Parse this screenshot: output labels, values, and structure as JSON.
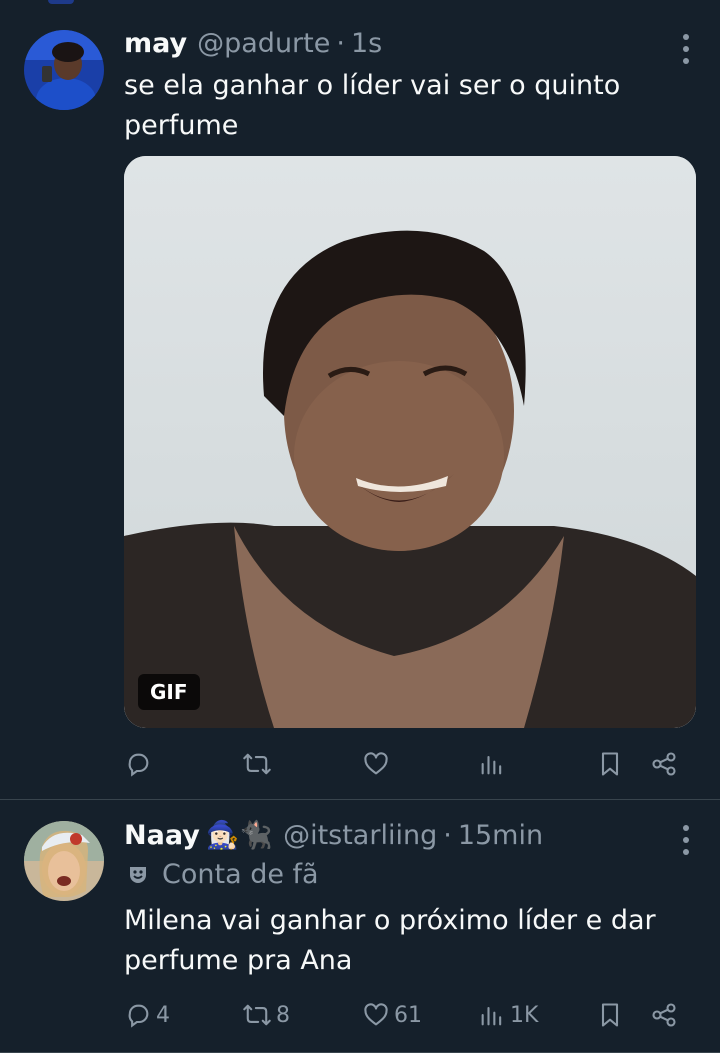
{
  "colors": {
    "background": "#15202b",
    "text": "#f7f9f9",
    "secondary": "#8b98a5",
    "divider": "#38444d"
  },
  "tweets": [
    {
      "name": "may",
      "handle": "@padurte",
      "separator": "·",
      "time": "1s",
      "text": "se ela ganhar o líder vai ser o quinto perfume",
      "media": {
        "type": "gif",
        "badge": "GIF"
      },
      "actions": {
        "reply": {
          "icon": "reply-icon",
          "count": ""
        },
        "retweet": {
          "icon": "retweet-icon",
          "count": ""
        },
        "like": {
          "icon": "heart-icon",
          "count": ""
        },
        "views": {
          "icon": "views-icon",
          "count": ""
        },
        "bookmark": {
          "icon": "bookmark-icon"
        },
        "share": {
          "icon": "share-icon"
        }
      }
    },
    {
      "name": "Naay",
      "emojis": "🧙🏻‍♀️🐈‍⬛",
      "handle": "@itstarliing",
      "separator": "·",
      "time": "15min",
      "label": "Conta de fã",
      "text": "Milena vai ganhar o próximo líder e dar perfume pra Ana",
      "actions": {
        "reply": {
          "icon": "reply-icon",
          "count": "4"
        },
        "retweet": {
          "icon": "retweet-icon",
          "count": "8"
        },
        "like": {
          "icon": "heart-icon",
          "count": "61"
        },
        "views": {
          "icon": "views-icon",
          "count": "1K"
        },
        "bookmark": {
          "icon": "bookmark-icon"
        },
        "share": {
          "icon": "share-icon"
        }
      }
    }
  ]
}
